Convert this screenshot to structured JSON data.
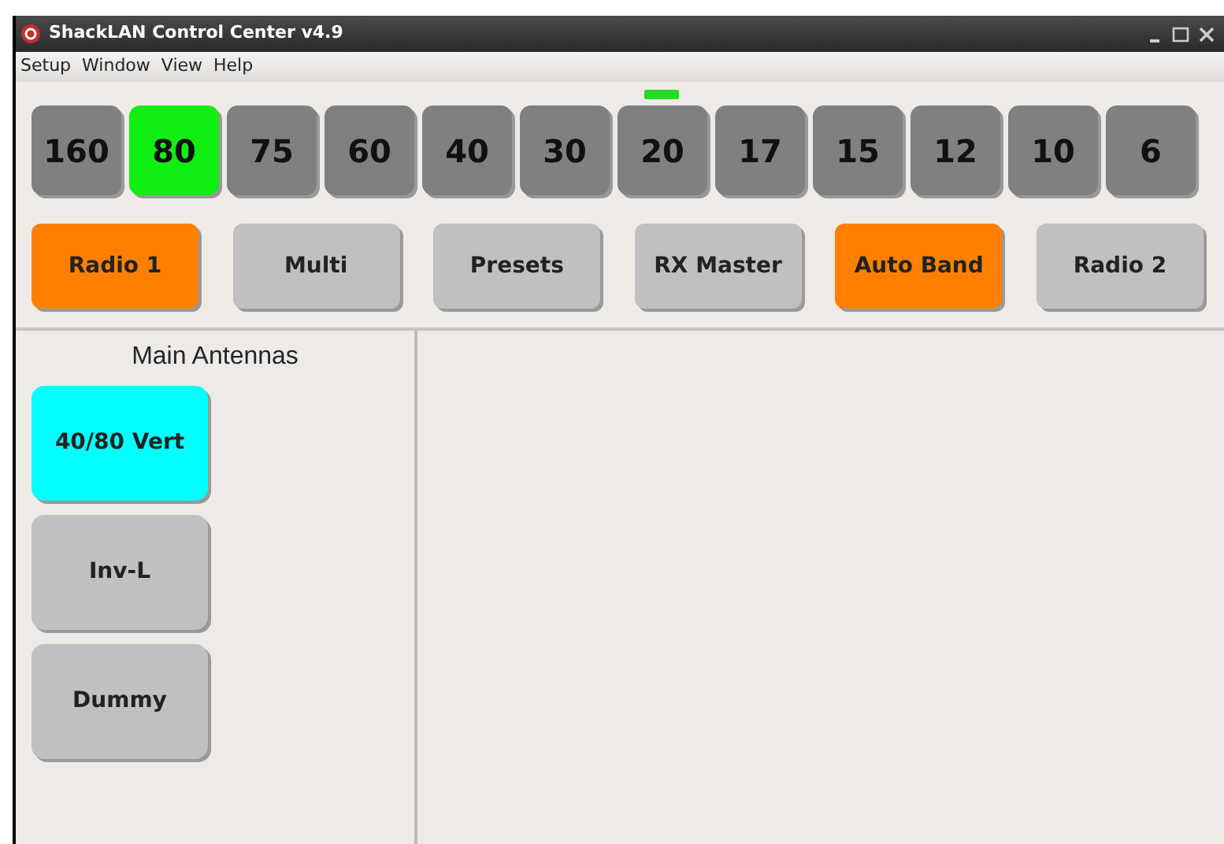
{
  "window": {
    "title": "ShackLAN Control Center v4.9"
  },
  "menu": [
    "Setup",
    "Window",
    "View",
    "Help"
  ],
  "bands": [
    {
      "label": "160",
      "selected": false,
      "indicator": false
    },
    {
      "label": "80",
      "selected": true,
      "indicator": false
    },
    {
      "label": "75",
      "selected": false,
      "indicator": false
    },
    {
      "label": "60",
      "selected": false,
      "indicator": false
    },
    {
      "label": "40",
      "selected": false,
      "indicator": false
    },
    {
      "label": "30",
      "selected": false,
      "indicator": false
    },
    {
      "label": "20",
      "selected": false,
      "indicator": true
    },
    {
      "label": "17",
      "selected": false,
      "indicator": false
    },
    {
      "label": "15",
      "selected": false,
      "indicator": false
    },
    {
      "label": "12",
      "selected": false,
      "indicator": false
    },
    {
      "label": "10",
      "selected": false,
      "indicator": false
    },
    {
      "label": "6",
      "selected": false,
      "indicator": false
    }
  ],
  "functions": [
    {
      "label": "Radio 1",
      "on": true
    },
    {
      "label": "Multi",
      "on": false
    },
    {
      "label": "Presets",
      "on": false
    },
    {
      "label": "RX Master",
      "on": false
    },
    {
      "label": "Auto Band",
      "on": true
    },
    {
      "label": "Radio 2",
      "on": false
    }
  ],
  "antenna_panel": {
    "title": "Main Antennas",
    "antennas": [
      {
        "label": "40/80 Vert",
        "selected": true
      },
      {
        "label": "Inv-L",
        "selected": false
      },
      {
        "label": "Dummy",
        "selected": false
      }
    ]
  }
}
